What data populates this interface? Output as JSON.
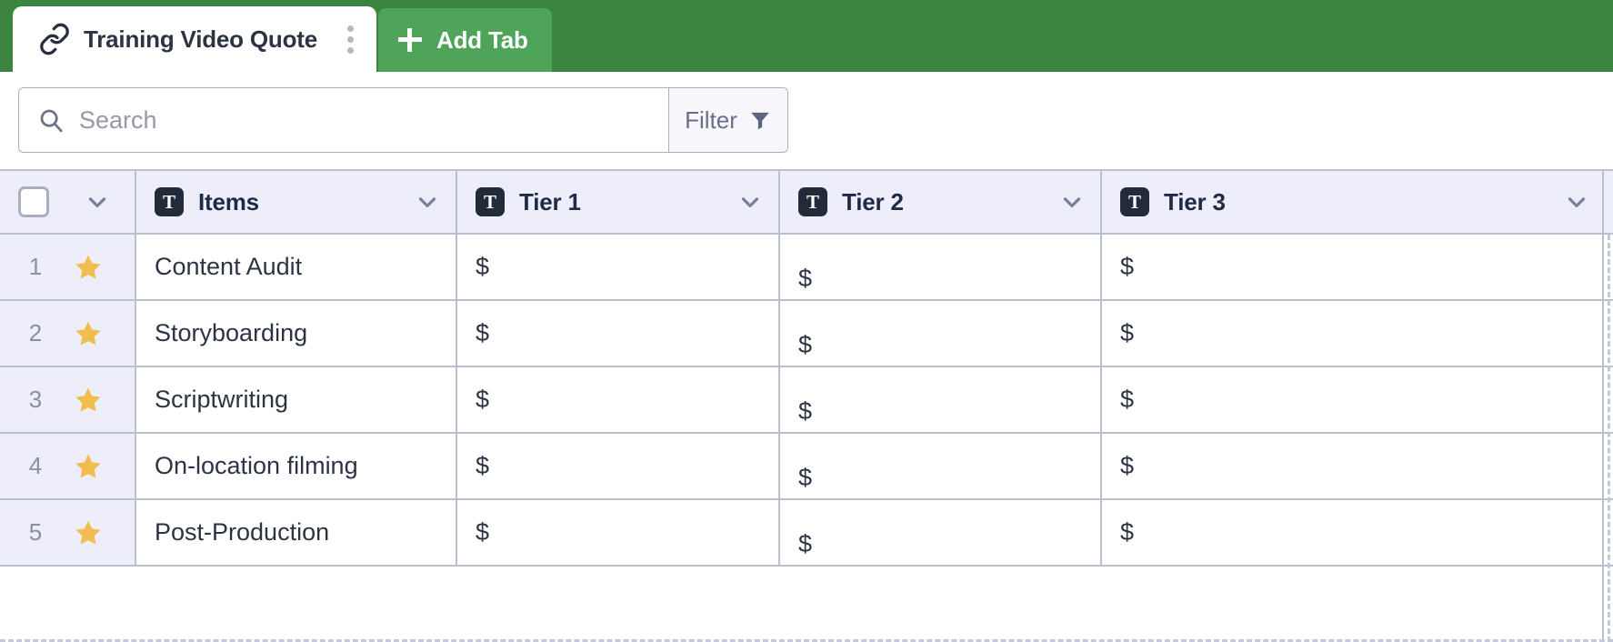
{
  "tab_bar": {
    "active_tab": {
      "icon": "link-icon",
      "title": "Training Video Quote",
      "menu_icon": "kebab-menu-icon"
    },
    "add_tab_label": "Add Tab",
    "add_tab_icon": "plus-icon",
    "bar_color": "#3b8440",
    "add_tab_color": "#4ea55a"
  },
  "toolbar": {
    "search": {
      "icon": "search-icon",
      "value": "",
      "placeholder": "Search"
    },
    "filter": {
      "label": "Filter",
      "icon": "funnel-icon"
    }
  },
  "table": {
    "header_bg": "#eeeefa",
    "select_all_checked": false,
    "columns": [
      {
        "type_icon": "text-type-icon",
        "type_letter": "T",
        "label": "Items",
        "menu_icon": "chevron-down-icon"
      },
      {
        "type_icon": "text-type-icon",
        "type_letter": "T",
        "label": "Tier 1",
        "menu_icon": "chevron-down-icon"
      },
      {
        "type_icon": "text-type-icon",
        "type_letter": "T",
        "label": "Tier 2",
        "menu_icon": "chevron-down-icon"
      },
      {
        "type_icon": "text-type-icon",
        "type_letter": "T",
        "label": "Tier 3",
        "menu_icon": "chevron-down-icon"
      }
    ],
    "rows": [
      {
        "number": "1",
        "star": "star-icon",
        "item": "Content Audit",
        "tier1": "$",
        "tier2": "$",
        "tier3": "$"
      },
      {
        "number": "2",
        "star": "star-icon",
        "item": "Storyboarding",
        "tier1": "$",
        "tier2": "$",
        "tier3": "$"
      },
      {
        "number": "3",
        "star": "star-icon",
        "item": "Scriptwriting",
        "tier1": "$",
        "tier2": "$",
        "tier3": "$"
      },
      {
        "number": "4",
        "star": "star-icon",
        "item": "On-location filming",
        "tier1": "$",
        "tier2": "$",
        "tier3": "$"
      },
      {
        "number": "5",
        "star": "star-icon",
        "item": "Post-Production",
        "tier1": "$",
        "tier2": "$",
        "tier3": "$"
      }
    ]
  }
}
